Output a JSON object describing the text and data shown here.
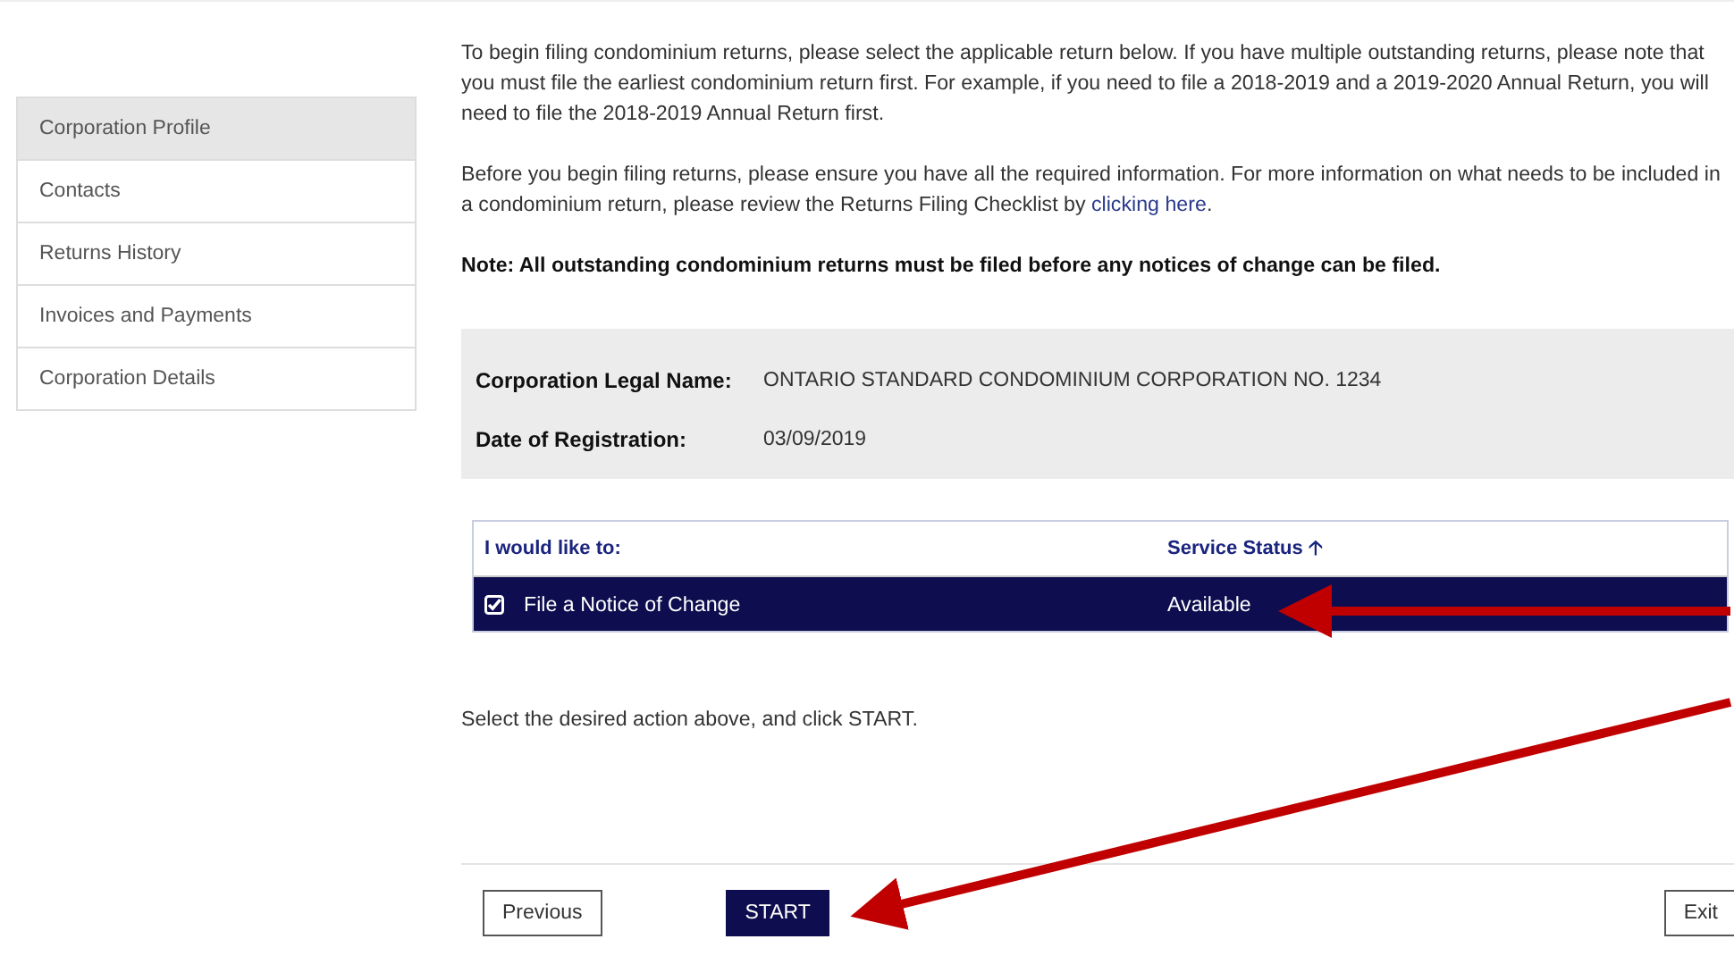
{
  "sidebar": {
    "items": [
      {
        "label": "Corporation Profile",
        "selected": true
      },
      {
        "label": "Contacts",
        "selected": false
      },
      {
        "label": "Returns History",
        "selected": false
      },
      {
        "label": "Invoices and Payments",
        "selected": false
      },
      {
        "label": "Corporation Details",
        "selected": false
      }
    ]
  },
  "intro": "To begin filing condominium returns, please select the applicable return below. If you have multiple outstanding returns, please note that you must file the earliest condominium return first. For example, if you need to file a 2018-2019 and a 2019-2020 Annual Return, you will need to file the 2018-2019 Annual Return first.",
  "info": {
    "before": "Before you begin filing returns, please ensure you have all the required information. For more information on what needs to be included in a condominium return, please review the Returns Filing Checklist by ",
    "link": "clicking here",
    "after": "."
  },
  "note": "Note: All outstanding condominium returns must be filed before any notices of change can be filed.",
  "details": [
    {
      "label": "Corporation Legal Name:",
      "value": "ONTARIO STANDARD CONDOMINIUM CORPORATION NO. 1234"
    },
    {
      "label": "Date of Registration:",
      "value": "03/09/2019"
    }
  ],
  "table": {
    "columns": [
      "I would like to:",
      "Service Status"
    ],
    "sort_icon": "🡡",
    "rows": [
      {
        "action": "File a Notice of Change",
        "status": "Available",
        "selected": true,
        "checked": true
      }
    ]
  },
  "instruction": "Select the desired action above, and click START.",
  "buttons": {
    "previous": "Previous",
    "start": "START",
    "exit": "Exit"
  }
}
